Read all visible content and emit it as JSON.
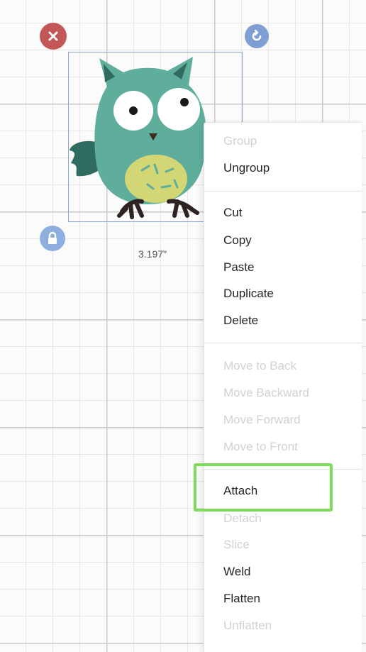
{
  "canvas": {
    "size_label": "3.197\"",
    "handles": {
      "delete_icon": "close-icon",
      "rotate_icon": "rotate-icon",
      "lock_icon": "lock-icon"
    },
    "image_icon": "owl-image"
  },
  "context_menu": {
    "group": "Group",
    "ungroup": "Ungroup",
    "cut": "Cut",
    "copy": "Copy",
    "paste": "Paste",
    "duplicate": "Duplicate",
    "delete": "Delete",
    "move_to_back": "Move to Back",
    "move_backward": "Move Backward",
    "move_forward": "Move Forward",
    "move_to_front": "Move to Front",
    "attach": "Attach",
    "detach": "Detach",
    "slice": "Slice",
    "weld": "Weld",
    "flatten": "Flatten",
    "unflatten": "Unflatten"
  },
  "colors": {
    "highlight": "#7edc5a",
    "delete_handle": "#c35656",
    "rotate_handle": "#7f9fd4",
    "lock_handle": "#8faee0",
    "owl_body": "#5fae9c"
  }
}
